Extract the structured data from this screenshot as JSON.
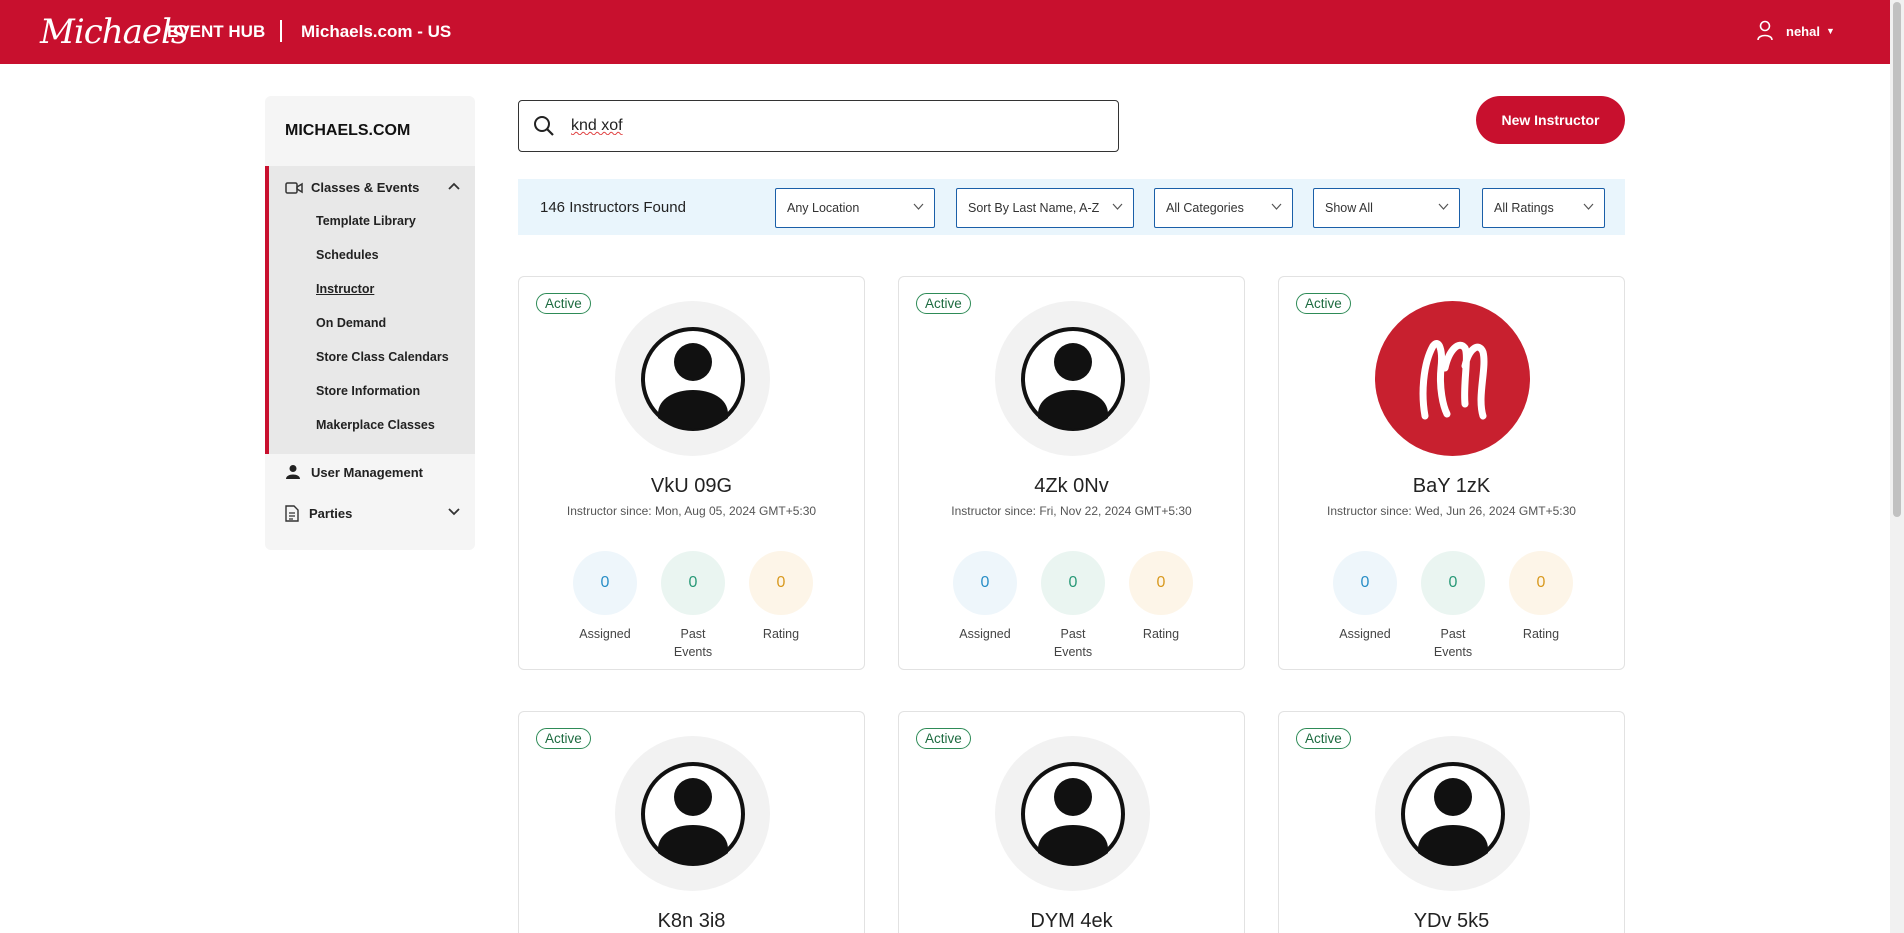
{
  "header": {
    "logo": "Michaels",
    "hub": "EVENT HUB",
    "site": "Michaels.com - US",
    "user": "nehal"
  },
  "sidebar": {
    "title": "MICHAELS.COM",
    "group_label": "Classes & Events",
    "sub_items": [
      {
        "label": "Template Library"
      },
      {
        "label": "Schedules"
      },
      {
        "label": "Instructor"
      },
      {
        "label": "On Demand"
      },
      {
        "label": "Store Class Calendars"
      },
      {
        "label": "Store Information"
      },
      {
        "label": "Makerplace Classes"
      }
    ],
    "user_management": "User Management",
    "parties": "Parties"
  },
  "search": {
    "value": "knd xof"
  },
  "new_instructor_label": "New Instructor",
  "filters": {
    "found": "146 Instructors Found",
    "location": "Any Location",
    "sort": "Sort By Last Name, A-Z",
    "categories": "All Categories",
    "show": "Show All",
    "ratings": "All Ratings"
  },
  "stat_labels": {
    "assigned": "Assigned",
    "past_line1": "Past",
    "past_line2": "Events",
    "rating": "Rating"
  },
  "instructors": [
    {
      "status": "Active",
      "name": "VkU 09G",
      "since": "Instructor since: Mon, Aug 05, 2024 GMT+5:30",
      "assigned": "0",
      "past": "0",
      "rating": "0"
    },
    {
      "status": "Active",
      "name": "4Zk 0Nv",
      "since": "Instructor since: Fri, Nov 22, 2024 GMT+5:30",
      "assigned": "0",
      "past": "0",
      "rating": "0"
    },
    {
      "status": "Active",
      "name": "BaY 1zK",
      "since": "Instructor since: Wed, Jun 26, 2024 GMT+5:30",
      "assigned": "0",
      "past": "0",
      "rating": "0"
    },
    {
      "status": "Active",
      "name": "K8n 3i8"
    },
    {
      "status": "Active",
      "name": "DYM 4ek"
    },
    {
      "status": "Active",
      "name": "YDv 5k5"
    }
  ],
  "colors": {
    "brand_red": "#c8102e",
    "active_green": "#2e8b57",
    "filter_bg": "#e9f5fc"
  }
}
